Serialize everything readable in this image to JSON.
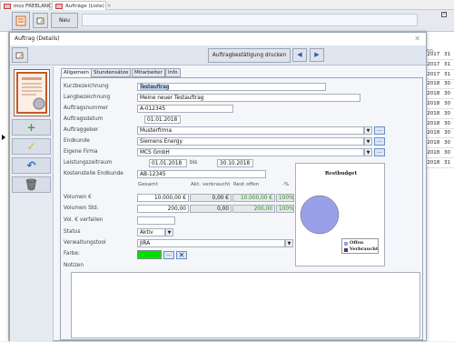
{
  "app_tabs": [
    {
      "label": "mcs FREELANCER"
    },
    {
      "label": "Aufträge (Liste)",
      "close": "✕"
    }
  ],
  "toolbar": {
    "new_label": "Neu"
  },
  "bg_list": {
    "rows": [
      [
        "2.2017",
        "31"
      ],
      [
        "2.2017",
        "31"
      ],
      [
        "2.2017",
        "31"
      ],
      [
        "3.2018",
        "30"
      ],
      [
        "3.2018",
        "30"
      ],
      [
        "3.2018",
        "30"
      ],
      [
        "3.2018",
        "30"
      ],
      [
        "3.2018",
        "30"
      ],
      [
        "3.2018",
        "30"
      ],
      [
        "3.2018",
        "30"
      ],
      [
        "3.2018",
        "30"
      ],
      [
        "5.2018",
        "31"
      ]
    ]
  },
  "dialog": {
    "title": "Auftrag (Details)",
    "close": "✕",
    "print_button": "Auftragbestätigung drucken",
    "tabs": [
      "Allgemein",
      "Stundensätze",
      "Mitarbeiter",
      "Info"
    ]
  },
  "form": {
    "kurzbezeichnung": {
      "label": "Kurzbezeichnung",
      "value": "Testauftrag"
    },
    "langbezeichnung": {
      "label": "Langbezeichnung",
      "value": "Meine neuer Testauftrag"
    },
    "auftragsnummer": {
      "label": "Auftragsnummer",
      "value": "A-012345"
    },
    "auftragsdatum": {
      "label": "Auftragsdatum",
      "value": "01.01.2018"
    },
    "auftraggeber": {
      "label": "Auftraggeber",
      "value": "Musterfirma"
    },
    "endkunde": {
      "label": "Endkunde",
      "value": "Siemens Energy"
    },
    "eigene_firma": {
      "label": "Eigene Firma",
      "value": "MCS GmbH"
    },
    "leistungszeitraum": {
      "label": "Leistungszeitraum",
      "from": "01.01.2018",
      "sep": "bis",
      "to": "30.10.2018"
    },
    "kostenstelle": {
      "label": "Kostenstelle Endkunde",
      "value": "AB-12345"
    },
    "col_headers": {
      "gesamt": "Gesamt",
      "akt": "Akt. verbraucht",
      "rest": "Rest offen",
      "pct": "-%"
    },
    "volumen_eur": {
      "label": "Volumen €",
      "gesamt": "10.000,00 €",
      "akt": "0,00 €",
      "rest": "10.000,00 €",
      "pct": "100%"
    },
    "volumen_std": {
      "label": "Volumen Std.",
      "gesamt": "200,00",
      "akt": "0,00",
      "rest": "200,00",
      "pct": "100%"
    },
    "vol_verfallen": {
      "label": "Vol. € verfallen"
    },
    "status": {
      "label": "Status",
      "value": "Aktiv"
    },
    "verwaltungstool": {
      "label": "Verwaltungstool",
      "value": "JIRA"
    },
    "farbe": {
      "label": "Farbe:",
      "color": "#00e000"
    },
    "notizen": {
      "label": "Notizen"
    }
  },
  "chart_data": {
    "type": "pie",
    "title": "Restbudget",
    "categories": [
      "Offen",
      "Verbraucht"
    ],
    "values": [
      100,
      0
    ],
    "colors": [
      "#9aa0e8",
      "#6a2a6a"
    ],
    "legend": "bottom-right"
  }
}
